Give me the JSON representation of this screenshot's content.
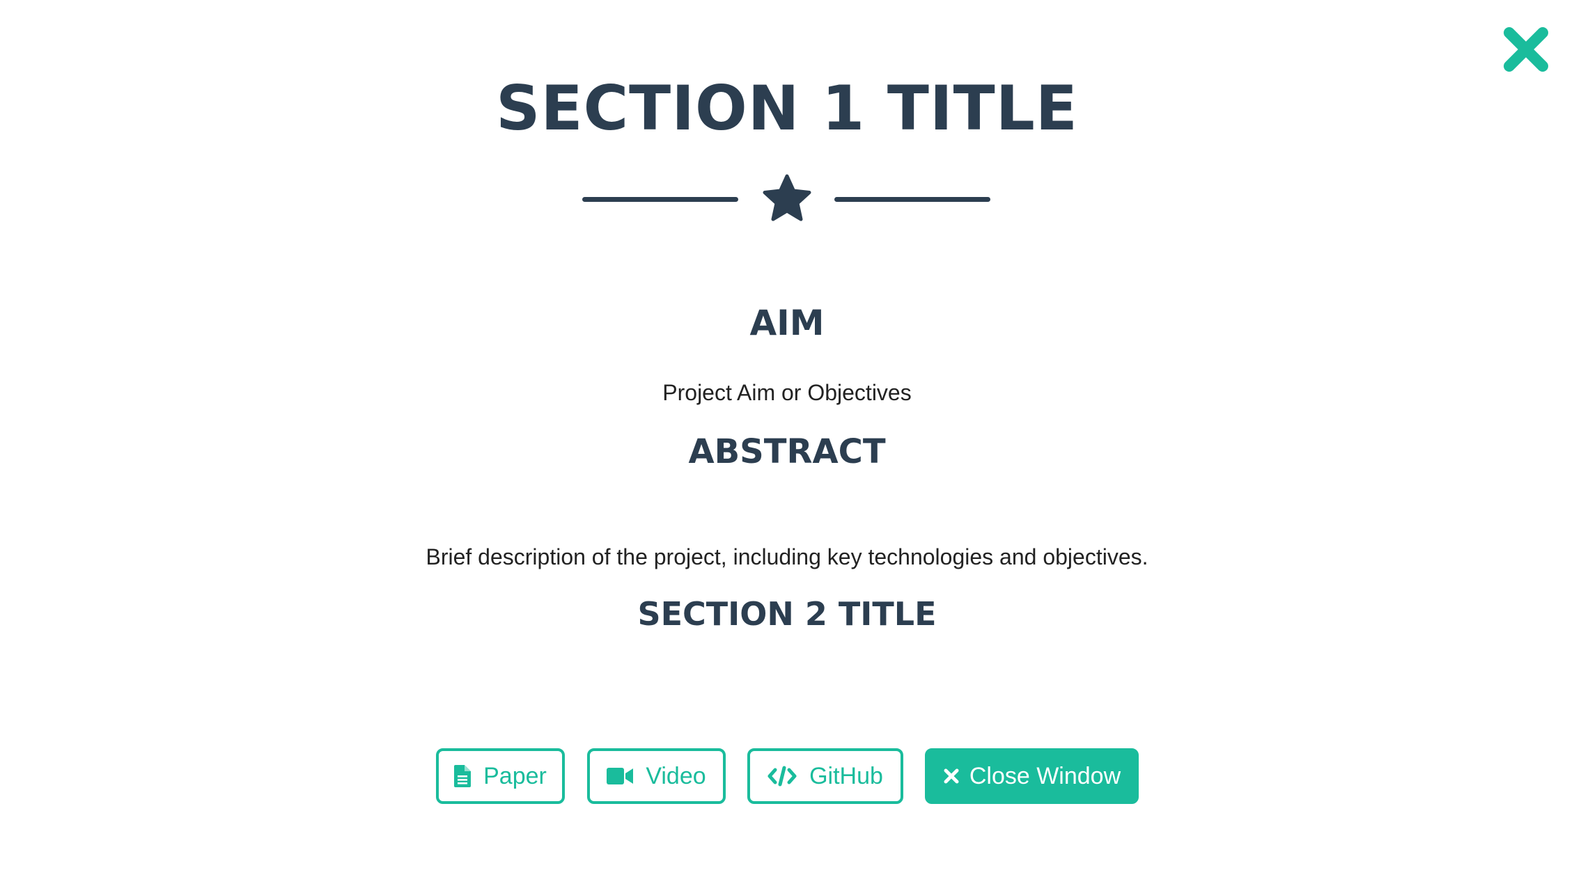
{
  "colors": {
    "primary_text": "#2c3e50",
    "accent": "#1abc9c",
    "background": "#ffffff"
  },
  "modal": {
    "close_icon": "close-x-icon",
    "title": "SECTION 1 TITLE",
    "divider_icon": "star-icon",
    "aim": {
      "heading": "AIM",
      "text": "Project Aim or Objectives"
    },
    "abstract": {
      "heading": "ABSTRACT",
      "text": "Brief description of the project, including key technologies and objectives."
    },
    "section2": {
      "heading": "SECTION 2 TITLE"
    },
    "buttons": {
      "paper": {
        "label": "Paper",
        "icon": "file-text-icon"
      },
      "video": {
        "label": "Video",
        "icon": "video-camera-icon"
      },
      "github": {
        "label": "GitHub",
        "icon": "code-icon"
      },
      "close": {
        "label": "Close Window",
        "icon": "times-icon"
      }
    }
  }
}
